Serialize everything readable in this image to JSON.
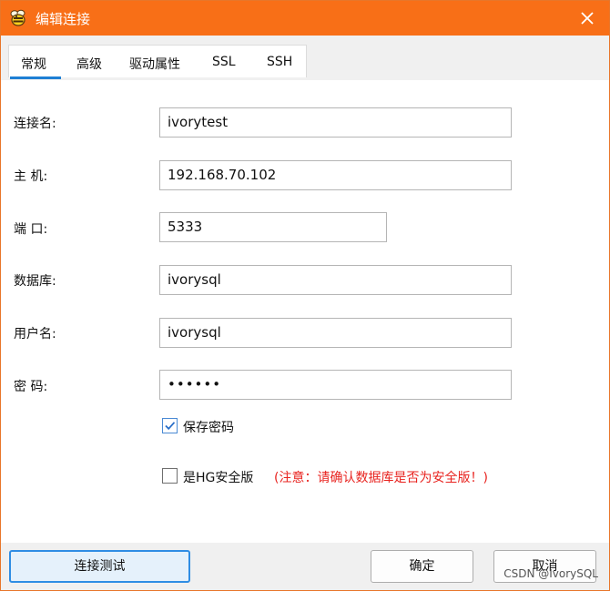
{
  "window": {
    "title": "编辑连接"
  },
  "tabs": [
    {
      "label": "常规",
      "active": true
    },
    {
      "label": "高级",
      "active": false
    },
    {
      "label": "驱动属性",
      "active": false
    },
    {
      "label": "SSL",
      "active": false
    },
    {
      "label": "SSH",
      "active": false
    }
  ],
  "form": {
    "connection_name": {
      "label": "连接名:",
      "value": "ivorytest"
    },
    "host": {
      "label": "主  机:",
      "value": "192.168.70.102"
    },
    "port": {
      "label": "端  口:",
      "value": "5333"
    },
    "database": {
      "label": "数据库:",
      "value": "ivorysql"
    },
    "username": {
      "label": "用户名:",
      "value": "ivorysql"
    },
    "password": {
      "label": "密  码:",
      "value": "••••••"
    }
  },
  "options": {
    "save_password": {
      "label": "保存密码",
      "checked": true
    },
    "hg_secure": {
      "label": "是HG安全版",
      "checked": false,
      "warning": "(注意：请确认数据库是否为安全版！)"
    }
  },
  "buttons": {
    "test": "连接测试",
    "ok": "确定",
    "cancel": "取消"
  },
  "watermark": "CSDN @IvorySQL",
  "colors": {
    "titlebar": "#f86f17",
    "accent": "#1f7fd4",
    "warning": "#e8231f"
  }
}
